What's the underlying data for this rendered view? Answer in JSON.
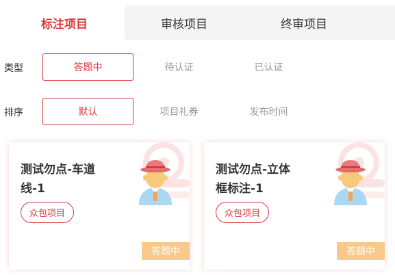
{
  "tabs": [
    {
      "label": "标注项目",
      "active": true
    },
    {
      "label": "审核项目",
      "active": false
    },
    {
      "label": "终审项目",
      "active": false
    }
  ],
  "filters": {
    "type": {
      "label": "类型",
      "options": [
        "答题中",
        "待认证",
        "已认证"
      ],
      "selected": "答题中"
    },
    "sort": {
      "label": "排序",
      "options": [
        "默认",
        "项目礼券",
        "发布时间"
      ],
      "selected": "默认"
    }
  },
  "cards": [
    {
      "title": "测试勿点-车道线-1",
      "tag": "众包项目",
      "status": "答题中",
      "avatar_icon": "worker-avatar-icon"
    },
    {
      "title": "测试勿点-立体框标注-1",
      "tag": "众包项目",
      "status": "答题中",
      "avatar_icon": "worker-avatar-icon"
    }
  ],
  "colors": {
    "accent": "#d9393d",
    "status_bg": "#f9c88a",
    "tab_bg": "#f4f4f4"
  }
}
